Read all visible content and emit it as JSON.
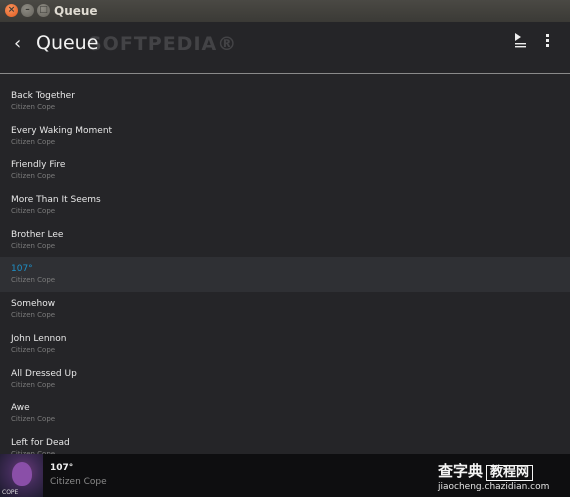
{
  "window": {
    "title": "Queue"
  },
  "header": {
    "back_glyph": "‹",
    "title": "Queue",
    "watermark": "SOFTPEDIA®"
  },
  "queue": [
    {
      "title": "Back Together",
      "artist": "Citizen Cope",
      "active": false
    },
    {
      "title": "Every Waking Moment",
      "artist": "Citizen Cope",
      "active": false
    },
    {
      "title": "Friendly Fire",
      "artist": "Citizen Cope",
      "active": false
    },
    {
      "title": "More Than It Seems",
      "artist": "Citizen Cope",
      "active": false
    },
    {
      "title": "Brother Lee",
      "artist": "Citizen Cope",
      "active": false
    },
    {
      "title": "107°",
      "artist": "Citizen Cope",
      "active": true
    },
    {
      "title": "Somehow",
      "artist": "Citizen Cope",
      "active": false
    },
    {
      "title": "John Lennon",
      "artist": "Citizen Cope",
      "active": false
    },
    {
      "title": "All Dressed Up",
      "artist": "Citizen Cope",
      "active": false
    },
    {
      "title": "Awe",
      "artist": "Citizen Cope",
      "active": false
    },
    {
      "title": "Left for Dead",
      "artist": "Citizen Cope",
      "active": false
    }
  ],
  "now_playing": {
    "title": "107°",
    "artist": "Citizen Cope",
    "art_text": "COPE"
  },
  "site_watermark": {
    "text": "查字典",
    "box": "教程网",
    "url": "jiaocheng.chazidian.com"
  },
  "colors": {
    "accent": "#1e90c8",
    "background": "#252528",
    "bottom_bar": "#0e0e10",
    "close_button": "#e25a1e"
  }
}
